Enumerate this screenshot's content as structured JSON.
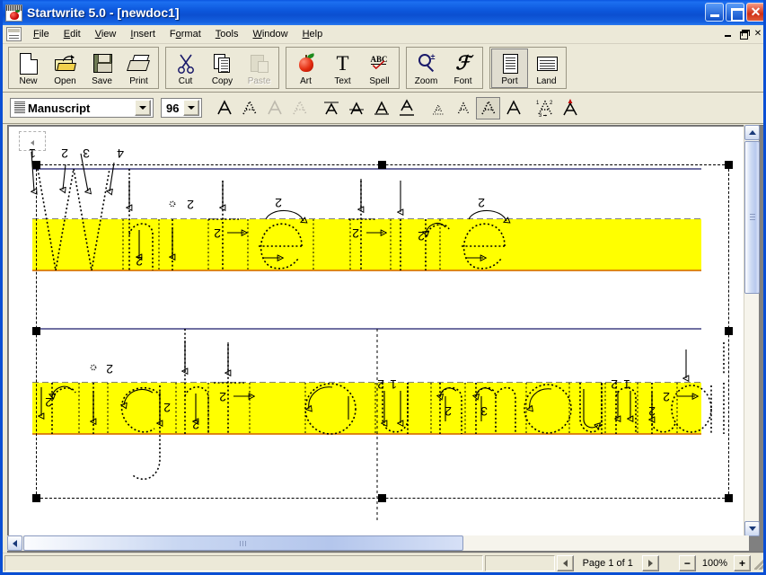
{
  "window": {
    "title": "Startwrite 5.0 - [newdoc1]",
    "icon": "startwrite-apple-icon",
    "buttons": {
      "minimize": "minimize-icon",
      "maximize": "maximize-icon",
      "close": "close-icon"
    }
  },
  "menubar": {
    "doc_icon": "document-icon",
    "items": [
      {
        "label": "File",
        "accel": "F"
      },
      {
        "label": "Edit",
        "accel": "E"
      },
      {
        "label": "View",
        "accel": "V"
      },
      {
        "label": "Insert",
        "accel": "I"
      },
      {
        "label": "Format",
        "accel": "o"
      },
      {
        "label": "Tools",
        "accel": "T"
      },
      {
        "label": "Window",
        "accel": "W"
      },
      {
        "label": "Help",
        "accel": "H"
      }
    ],
    "mdi_buttons": {
      "minimize": "mdi-minimize-icon",
      "restore": "mdi-restore-icon",
      "close": "mdi-close-icon",
      "close_glyph": "✕"
    }
  },
  "toolbar": {
    "groups": [
      {
        "name": "file-group",
        "buttons": [
          {
            "label": "New",
            "icon": "new-document-icon",
            "disabled": false
          },
          {
            "label": "Open",
            "icon": "open-folder-icon",
            "disabled": false
          },
          {
            "label": "Save",
            "icon": "floppy-disk-icon",
            "disabled": false
          },
          {
            "label": "Print",
            "icon": "printer-icon",
            "disabled": false
          }
        ]
      },
      {
        "name": "edit-group",
        "buttons": [
          {
            "label": "Cut",
            "icon": "scissors-icon",
            "disabled": false
          },
          {
            "label": "Copy",
            "icon": "copy-pages-icon",
            "disabled": false
          },
          {
            "label": "Paste",
            "icon": "clipboard-icon",
            "disabled": true
          }
        ]
      },
      {
        "name": "insert-group",
        "buttons": [
          {
            "label": "Art",
            "icon": "apple-art-icon",
            "disabled": false
          },
          {
            "label": "Text",
            "icon": "text-t-icon",
            "disabled": false
          },
          {
            "label": "Spell",
            "icon": "spell-check-icon",
            "disabled": false
          }
        ]
      },
      {
        "name": "view-group",
        "buttons": [
          {
            "label": "Zoom",
            "icon": "magnifier-icon",
            "disabled": false
          },
          {
            "label": "Font",
            "icon": "script-f-icon",
            "disabled": false
          }
        ]
      },
      {
        "name": "orientation-group",
        "buttons": [
          {
            "label": "Port",
            "icon": "portrait-page-icon",
            "disabled": false,
            "pressed": true
          },
          {
            "label": "Land",
            "icon": "landscape-page-icon",
            "disabled": false,
            "pressed": false
          }
        ]
      }
    ]
  },
  "formatbar": {
    "font": {
      "value": "Manuscript",
      "icon": "font-preview-icon",
      "dropdown": "chevron-down-icon"
    },
    "size": {
      "value": "96",
      "dropdown": "chevron-down-icon"
    },
    "style_group_1": [
      {
        "name": "letter-solid-button",
        "icon": "solid-a-icon",
        "active": false
      },
      {
        "name": "letter-dotted-button",
        "icon": "dotted-a-icon",
        "active": false
      },
      {
        "name": "letter-gray-button",
        "icon": "gray-a-icon",
        "active": false
      },
      {
        "name": "letter-gray-dotted-button",
        "icon": "gray-dotted-a-icon",
        "active": false
      }
    ],
    "style_group_2": [
      {
        "name": "topline-button",
        "icon": "a-overline-icon",
        "active": false
      },
      {
        "name": "midline-button",
        "icon": "a-midline-icon",
        "active": false
      },
      {
        "name": "baseline-button",
        "icon": "a-underline-icon",
        "active": false
      },
      {
        "name": "descender-line-button",
        "icon": "a-descender-icon",
        "active": false
      }
    ],
    "style_group_3": [
      {
        "name": "size-small-button",
        "icon": "small-dotted-a-icon",
        "active": false
      },
      {
        "name": "size-medium-button",
        "icon": "medium-dotted-a-icon",
        "active": false
      },
      {
        "name": "size-large-button",
        "icon": "large-dotted-a-icon",
        "active": true
      },
      {
        "name": "size-solid-button",
        "icon": "large-solid-a-icon",
        "active": false
      }
    ],
    "style_group_4": [
      {
        "name": "stroke-numbers-button",
        "icon": "numbered-strokes-a-icon",
        "active": false
      },
      {
        "name": "start-dot-button",
        "icon": "start-arrow-a-icon",
        "active": false
      }
    ]
  },
  "document": {
    "highlight_color": "#ffff00",
    "baseline_color": "#d97706",
    "guide_color": "#000080",
    "stroke_color": "#000000",
    "selected": true,
    "lines": [
      {
        "text": "White tire",
        "letters": [
          "W",
          "h",
          "i",
          "t",
          "e",
          "t",
          "i",
          "r",
          "e"
        ]
      },
      {
        "text": "right on mountain",
        "letters": [
          "r",
          "i",
          "g",
          "h",
          "t",
          "o",
          "u",
          "n",
          "m",
          "o",
          "u",
          "n",
          "t",
          "a",
          "i",
          "n"
        ]
      }
    ]
  },
  "scrollbars": {
    "vertical": {
      "up": "scroll-up-icon",
      "down": "scroll-down-icon",
      "thumb_top_pct": 4,
      "thumb_height_pct": 37
    },
    "horizontal": {
      "left": "scroll-left-icon",
      "right": "scroll-right-icon",
      "thumb_left_pct": 2,
      "thumb_width_pct": 61
    }
  },
  "statusbar": {
    "message": "",
    "prev_page": "previous-page-icon",
    "next_page": "next-page-icon",
    "page_label": "Page 1 of 1",
    "zoom_out": "−",
    "zoom_level": "100%",
    "zoom_in": "+",
    "resize_grip": "resize-grip-icon"
  }
}
